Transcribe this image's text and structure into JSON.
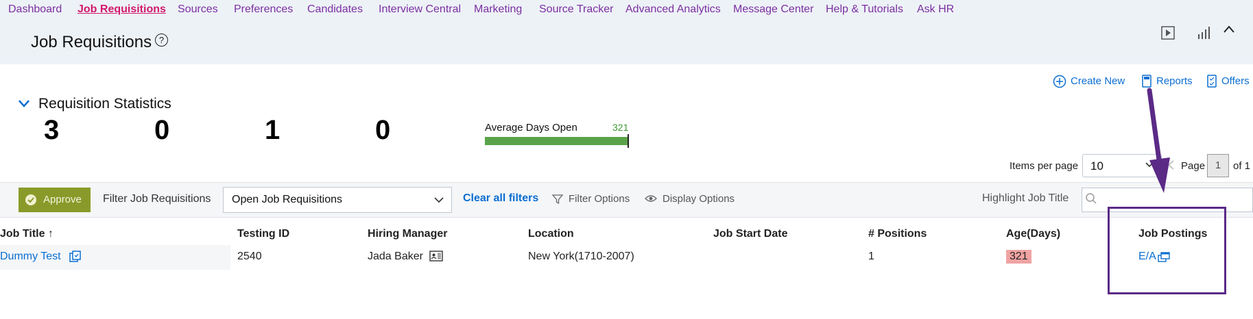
{
  "nav": {
    "items": [
      "Dashboard",
      "Job Requisitions",
      "Sources",
      "Preferences",
      "Candidates",
      "Interview Central",
      "Marketing",
      "Source Tracker",
      "Advanced Analytics",
      "Message Center",
      "Help & Tutorials",
      "Ask HR"
    ],
    "active_index": 1
  },
  "header": {
    "title": "Job Requisitions",
    "help_glyph": "?"
  },
  "actions": {
    "create_new": "Create New",
    "reports": "Reports",
    "offers": "Offers"
  },
  "stats": {
    "title": "Requisition Statistics",
    "values": [
      "3",
      "0",
      "1",
      "0"
    ],
    "avg_days_label": "Average Days Open",
    "avg_days_value": "321"
  },
  "pagination": {
    "items_per_page_label": "Items per page",
    "items_per_page": "10",
    "page_label": "Page",
    "page": "1",
    "of_label": "of 1"
  },
  "filters": {
    "approve_label": "Approve",
    "filter_label": "Filter Job Requisitions",
    "filter_value": "Open Job Requisitions",
    "clear_all": "Clear all filters",
    "filter_options": "Filter Options",
    "display_options": "Display Options",
    "highlight_label": "Highlight Job Title",
    "highlight_placeholder": ""
  },
  "table": {
    "columns": [
      "Job Title",
      "Testing ID",
      "Hiring Manager",
      "Location",
      "Job Start Date",
      "# Positions",
      "Age(Days)",
      "Job Postings"
    ],
    "sort_glyph": "↑",
    "rows": [
      {
        "job_title": "Dummy Test",
        "testing_id": "2540",
        "hiring_manager": "Jada Baker",
        "location": "New York(1710-2007)",
        "job_start_date": "",
        "positions": "1",
        "age_days": "321",
        "job_postings": "E/A"
      }
    ]
  },
  "colors": {
    "accent": "#0a6ed1",
    "nav_link": "#7b2fa0",
    "nav_active": "#d2196b",
    "approve": "#8a9a2a",
    "age_badge": "#f0a3a3",
    "annotation": "#5b2a86"
  }
}
